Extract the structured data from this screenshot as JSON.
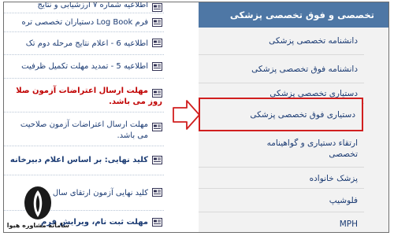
{
  "news": {
    "items": [
      {
        "text": "اطلاعیه شماره ۷ ارزشیابی و نتایج",
        "style": "normal"
      },
      {
        "text": "فرم Log Book دستیاران تخصصی تره",
        "style": "normal"
      },
      {
        "text": "اطلاعیه 6 - اعلام نتایج مرحله دوم تک",
        "style": "normal"
      },
      {
        "text": "اطلاعیه 5 - تمدید مهلت تکمیل ظرفیت",
        "style": "normal"
      },
      {
        "text": "مهلت ارسال اعتراضات آزمون صلا",
        "text2": "روز                     می باشد.",
        "style": "red"
      },
      {
        "text": "مهلت ارسال اعتراضات آزمون صلاحیت",
        "text2": "می باشد.",
        "style": "normal"
      },
      {
        "text": "کلید نهایی: بر اساس اعلام دبیرخانه",
        "style": "bold"
      },
      {
        "text": "کلید نهایی آزمون ارتقای سال",
        "style": "normal"
      },
      {
        "text": "مهلت ثبت نام، ویرایش فرم",
        "style": "normal"
      }
    ]
  },
  "menu": {
    "header": "تخصصی و فوق تخصصی پزشکی",
    "items": [
      {
        "label": "دانشنامه تخصصی پزشکی"
      },
      {
        "label": "دانشنامه فوق تخصصی پزشکی"
      },
      {
        "label": "دستیاری تخصصی پزشکی"
      },
      {
        "label": "دستیاری فوق تخصصی پزشکی",
        "highlight": true
      },
      {
        "label": "ارتقاء دستیاری و گواهینامه",
        "label2": "تخصصی"
      },
      {
        "label": "پزشک خانواده"
      },
      {
        "label": "فلوشیپ"
      },
      {
        "label": "MPH"
      }
    ]
  },
  "logo": {
    "text": "سامانه مشاوره هیوا"
  },
  "colors": {
    "menu_header": "#4e77a5",
    "highlight_border": "#d11f1f",
    "link": "#1b3b73",
    "alert": "#c00000"
  }
}
